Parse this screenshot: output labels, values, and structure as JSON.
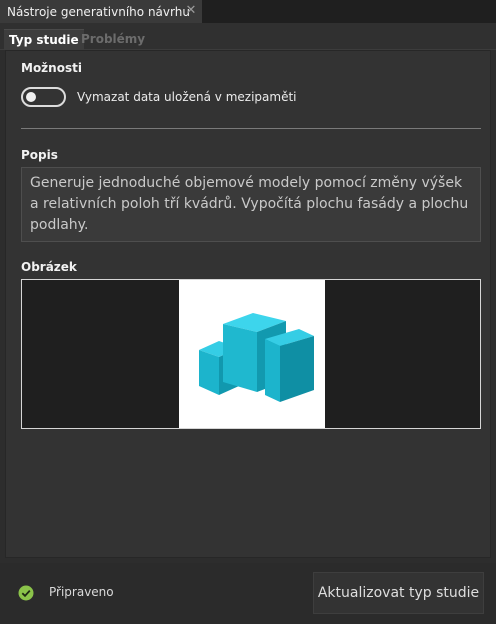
{
  "window": {
    "tab_title": "Nástroje generativního návrhu",
    "close_glyph": "✕"
  },
  "tabs": [
    {
      "label": "Typ studie",
      "active": true
    },
    {
      "label": "Problémy",
      "active": false
    }
  ],
  "options": {
    "heading": "Možnosti",
    "toggle": {
      "label": "Vymazat data uložená v mezipaměti",
      "checked": false
    }
  },
  "description": {
    "heading": "Popis",
    "text": "Generuje jednoduché objemové modely pomocí změny výšek a relativních poloh tří kvádrů. Vypočítá plochu fasády a plochu podlahy."
  },
  "image": {
    "heading": "Obrázek"
  },
  "footer": {
    "status_text": "Připraveno",
    "status_icon": "check-circle-icon",
    "status_color": "#8bc34a",
    "update_button_label": "Aktualizovat typ studie"
  },
  "colors": {
    "accent_cyan": "#1ab5d0"
  }
}
